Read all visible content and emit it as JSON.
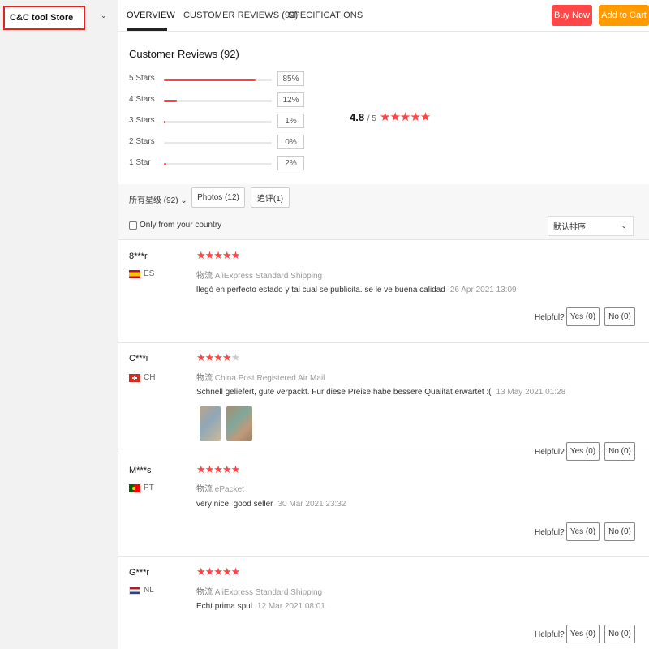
{
  "store": {
    "name": "C&C tool Store"
  },
  "tabs": [
    {
      "label": "OVERVIEW",
      "active": true
    },
    {
      "label": "CUSTOMER REVIEWS (92)",
      "active": false
    },
    {
      "label": "SPECIFICATIONS",
      "active": false
    }
  ],
  "actions": {
    "buy_now": "Buy Now",
    "add_to_cart": "Add to Cart"
  },
  "reviews_summary": {
    "title": "Customer Reviews (92)",
    "average": "4.8",
    "out_of": "/ 5",
    "average_stars": "★★★★★",
    "distribution": [
      {
        "label": "5 Stars",
        "percent": "85%",
        "fraction": 0.85
      },
      {
        "label": "4 Stars",
        "percent": "12%",
        "fraction": 0.12
      },
      {
        "label": "3 Stars",
        "percent": "1%",
        "fraction": 0.01
      },
      {
        "label": "2 Stars",
        "percent": "0%",
        "fraction": 0.0
      },
      {
        "label": "1 Star",
        "percent": "2%",
        "fraction": 0.02
      }
    ]
  },
  "filters": {
    "all_ratings": "所有星级 (92)",
    "photos": "Photos (12)",
    "additional": "追评(1)",
    "only_country": "Only from your country",
    "sort": "默认排序"
  },
  "colors": {
    "accent_red": "#ff4747",
    "accent_orange": "#ff9a00",
    "star": "#ff4444"
  },
  "reviews": [
    {
      "name": "8***r",
      "country": "ES",
      "stars_full": "★★★★★",
      "stars_empty": "",
      "ship_key": "物流",
      "shipping": "AliExpress Standard Shipping",
      "text": "llegó en perfecto estado y tal cual se publicita. se le ve buena calidad",
      "date": "26 Apr 2021 13:09",
      "helpful": "Helpful?",
      "yes": "Yes (0)",
      "no": "No (0)"
    },
    {
      "name": "C***i",
      "country": "CH",
      "stars_full": "★★★★",
      "stars_empty": "★",
      "ship_key": "物流",
      "shipping": "China Post Registered Air Mail",
      "text": "Schnell geliefert, gute verpackt. Für diese Preise habe bessere Qualität erwartet :(",
      "date": "13 May 2021 01:28",
      "helpful": "Helpful?",
      "yes": "Yes (0)",
      "no": "No (0)"
    },
    {
      "name": "M***s",
      "country": "PT",
      "stars_full": "★★★★★",
      "stars_empty": "",
      "ship_key": "物流",
      "shipping": "ePacket",
      "text": "very nice. good seller",
      "date": "30 Mar 2021 23:32",
      "helpful": "Helpful?",
      "yes": "Yes (0)",
      "no": "No (0)"
    },
    {
      "name": "G***r",
      "country": "NL",
      "stars_full": "★★★★★",
      "stars_empty": "",
      "ship_key": "物流",
      "shipping": "AliExpress Standard Shipping",
      "text": "Echt prima spul",
      "date": "12 Mar 2021 08:01",
      "helpful": "Helpful?",
      "yes": "Yes (0)",
      "no": "No (0)"
    }
  ]
}
